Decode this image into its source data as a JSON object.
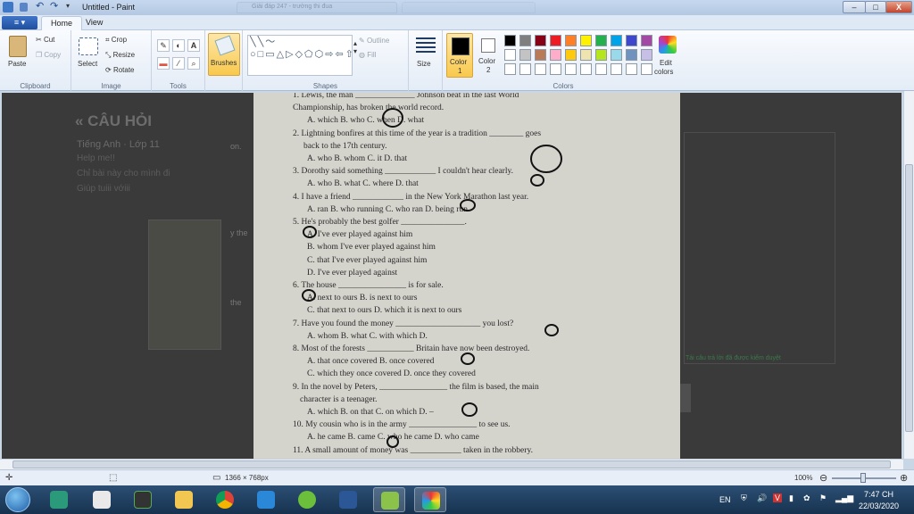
{
  "window": {
    "title": "Untitled - Paint"
  },
  "browser_tabs": [
    {
      "label": "Giải đáp 247 - trường thi đua"
    },
    {
      "label": ""
    }
  ],
  "controls": {
    "minimize": "–",
    "maximize": "□",
    "close": "X"
  },
  "ribbon_tabs": {
    "file": "▾",
    "home": "Home",
    "view": "View"
  },
  "clipboard": {
    "paste": "Paste",
    "cut": "Cut",
    "copy": "Copy",
    "label": "Clipboard"
  },
  "image": {
    "select": "Select",
    "crop": "Crop",
    "resize": "Resize",
    "rotate": "Rotate",
    "label": "Image"
  },
  "tools": {
    "label": "Tools",
    "text": "A"
  },
  "brushes": {
    "label": "Brushes"
  },
  "shapes": {
    "outline": "Outline",
    "fill": "Fill",
    "label": "Shapes"
  },
  "size": {
    "label": "Size"
  },
  "colors": {
    "color1_label": "Color",
    "color1_num": "1",
    "color2_label": "Color",
    "color2_num": "2",
    "edit": "Edit",
    "edit2": "colors",
    "label": "Colors",
    "palette": [
      "#000000",
      "#7f7f7f",
      "#880015",
      "#ed1c24",
      "#ff7f27",
      "#fff200",
      "#22b14c",
      "#00a2e8",
      "#3f48cc",
      "#a349a4",
      "#ffffff",
      "#c3c3c3",
      "#b97a57",
      "#ffaec9",
      "#ffc90e",
      "#efe4b0",
      "#b5e61d",
      "#99d9ea",
      "#7092be",
      "#c8bfe7",
      "#ffffff",
      "#ffffff",
      "#ffffff",
      "#ffffff",
      "#ffffff",
      "#ffffff",
      "#ffffff",
      "#ffffff",
      "#ffffff",
      "#ffffff"
    ]
  },
  "page": {
    "heading": "« CÂU HỎI",
    "subject": "Tiếng Anh · Lớp 11",
    "line1": "Help me!!",
    "line2": "Chỉ bài này cho mình đi",
    "line3": "Giúp tuiii vớiii",
    "side_left": [
      "on.",
      "y the",
      "the"
    ],
    "notice": "Tải câu trả lời đã được kiểm duyệt"
  },
  "worksheet": [
    "1. Lewis, the man ______________ Johnson beat in the last World",
    "Championship, has broken the world record.",
    "A. which          B. who          C. when          D. what",
    "2. Lightning bonfires at this time of the year is a tradition ________ goes",
    "back to the 17th century.",
    "A. who            B. whom         C. it              D. that",
    "3. Dorothy said something ____________ I couldn't hear clearly.",
    "A. who            B. what          C. where        D. that",
    "4. I have a friend ____________ in the New York Marathon last year.",
    "A. ran             B. who running  C. who ran       D. being run",
    "5. He's probably the best golfer _______________.",
    "A. I've ever played against him",
    "B. whom I've ever played against him",
    "C. that I've ever played against him",
    "D. I've ever played against",
    "6. The house ________________ is for sale.",
    "A. next to ours                     B. is next to ours",
    "C. that next to ours              D. which it is next to ours",
    "7. Have you found the money ____________________ you lost?",
    "A. whom           B. what          C. with which    D.",
    "8. Most of the forests ___________ Britain have now been destroyed.",
    "A. that once covered          B. once covered",
    "C. which they once covered    D. once they covered",
    "9. In the novel by Peters, ________________ the film is based, the main",
    "character is a teenager.",
    "A. which          B. on that       C. on which      D. –",
    "10. My cousin who is in the army ________________ to see us.",
    "A. he came       B. came          C. who he came   D. who came",
    "11. A small amount of money was ____________ taken in the robbery."
  ],
  "status": {
    "dimensions": "1366 × 768px",
    "zoom": "100%"
  },
  "taskbar": {
    "lang": "EN",
    "time": "7:47 CH",
    "date": "22/03/2020",
    "apps": [
      "start",
      "ab",
      "un",
      "nox",
      "folder",
      "chrome",
      "store",
      "lime",
      "word",
      "paint-frame",
      "paint"
    ]
  }
}
